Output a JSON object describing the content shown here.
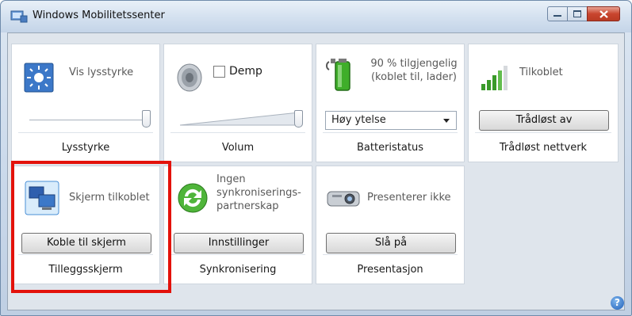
{
  "window": {
    "title": "Windows Mobilitetssenter"
  },
  "tiles": {
    "brightness": {
      "text": "Vis lysstyrke",
      "label": "Lysstyrke",
      "slider_level": 1.0
    },
    "volume": {
      "mute_label": "Demp",
      "label": "Volum",
      "slider_level": 1.0,
      "muted": false
    },
    "battery": {
      "status_line1": "90 % tilgjengelig",
      "status_line2": "(koblet til, lader)",
      "plan": "Høy ytelse",
      "label": "Batteristatus"
    },
    "wireless": {
      "status": "Tilkoblet",
      "button": "Trådløst av",
      "label": "Trådløst nettverk"
    },
    "display": {
      "text": "Skjerm tilkoblet",
      "button": "Koble til skjerm",
      "label": "Tilleggsskjerm"
    },
    "sync": {
      "line1": "Ingen",
      "line2": "synkroniserings-",
      "line3": "partnerskap",
      "button": "Innstillinger",
      "label": "Synkronisering"
    },
    "presentation": {
      "text": "Presenterer ikke",
      "button": "Slå på",
      "label": "Presentasjon"
    }
  },
  "help": {
    "glyph": "?"
  },
  "colors": {
    "highlight": "#e3120b",
    "close_button": "#c9452e"
  }
}
